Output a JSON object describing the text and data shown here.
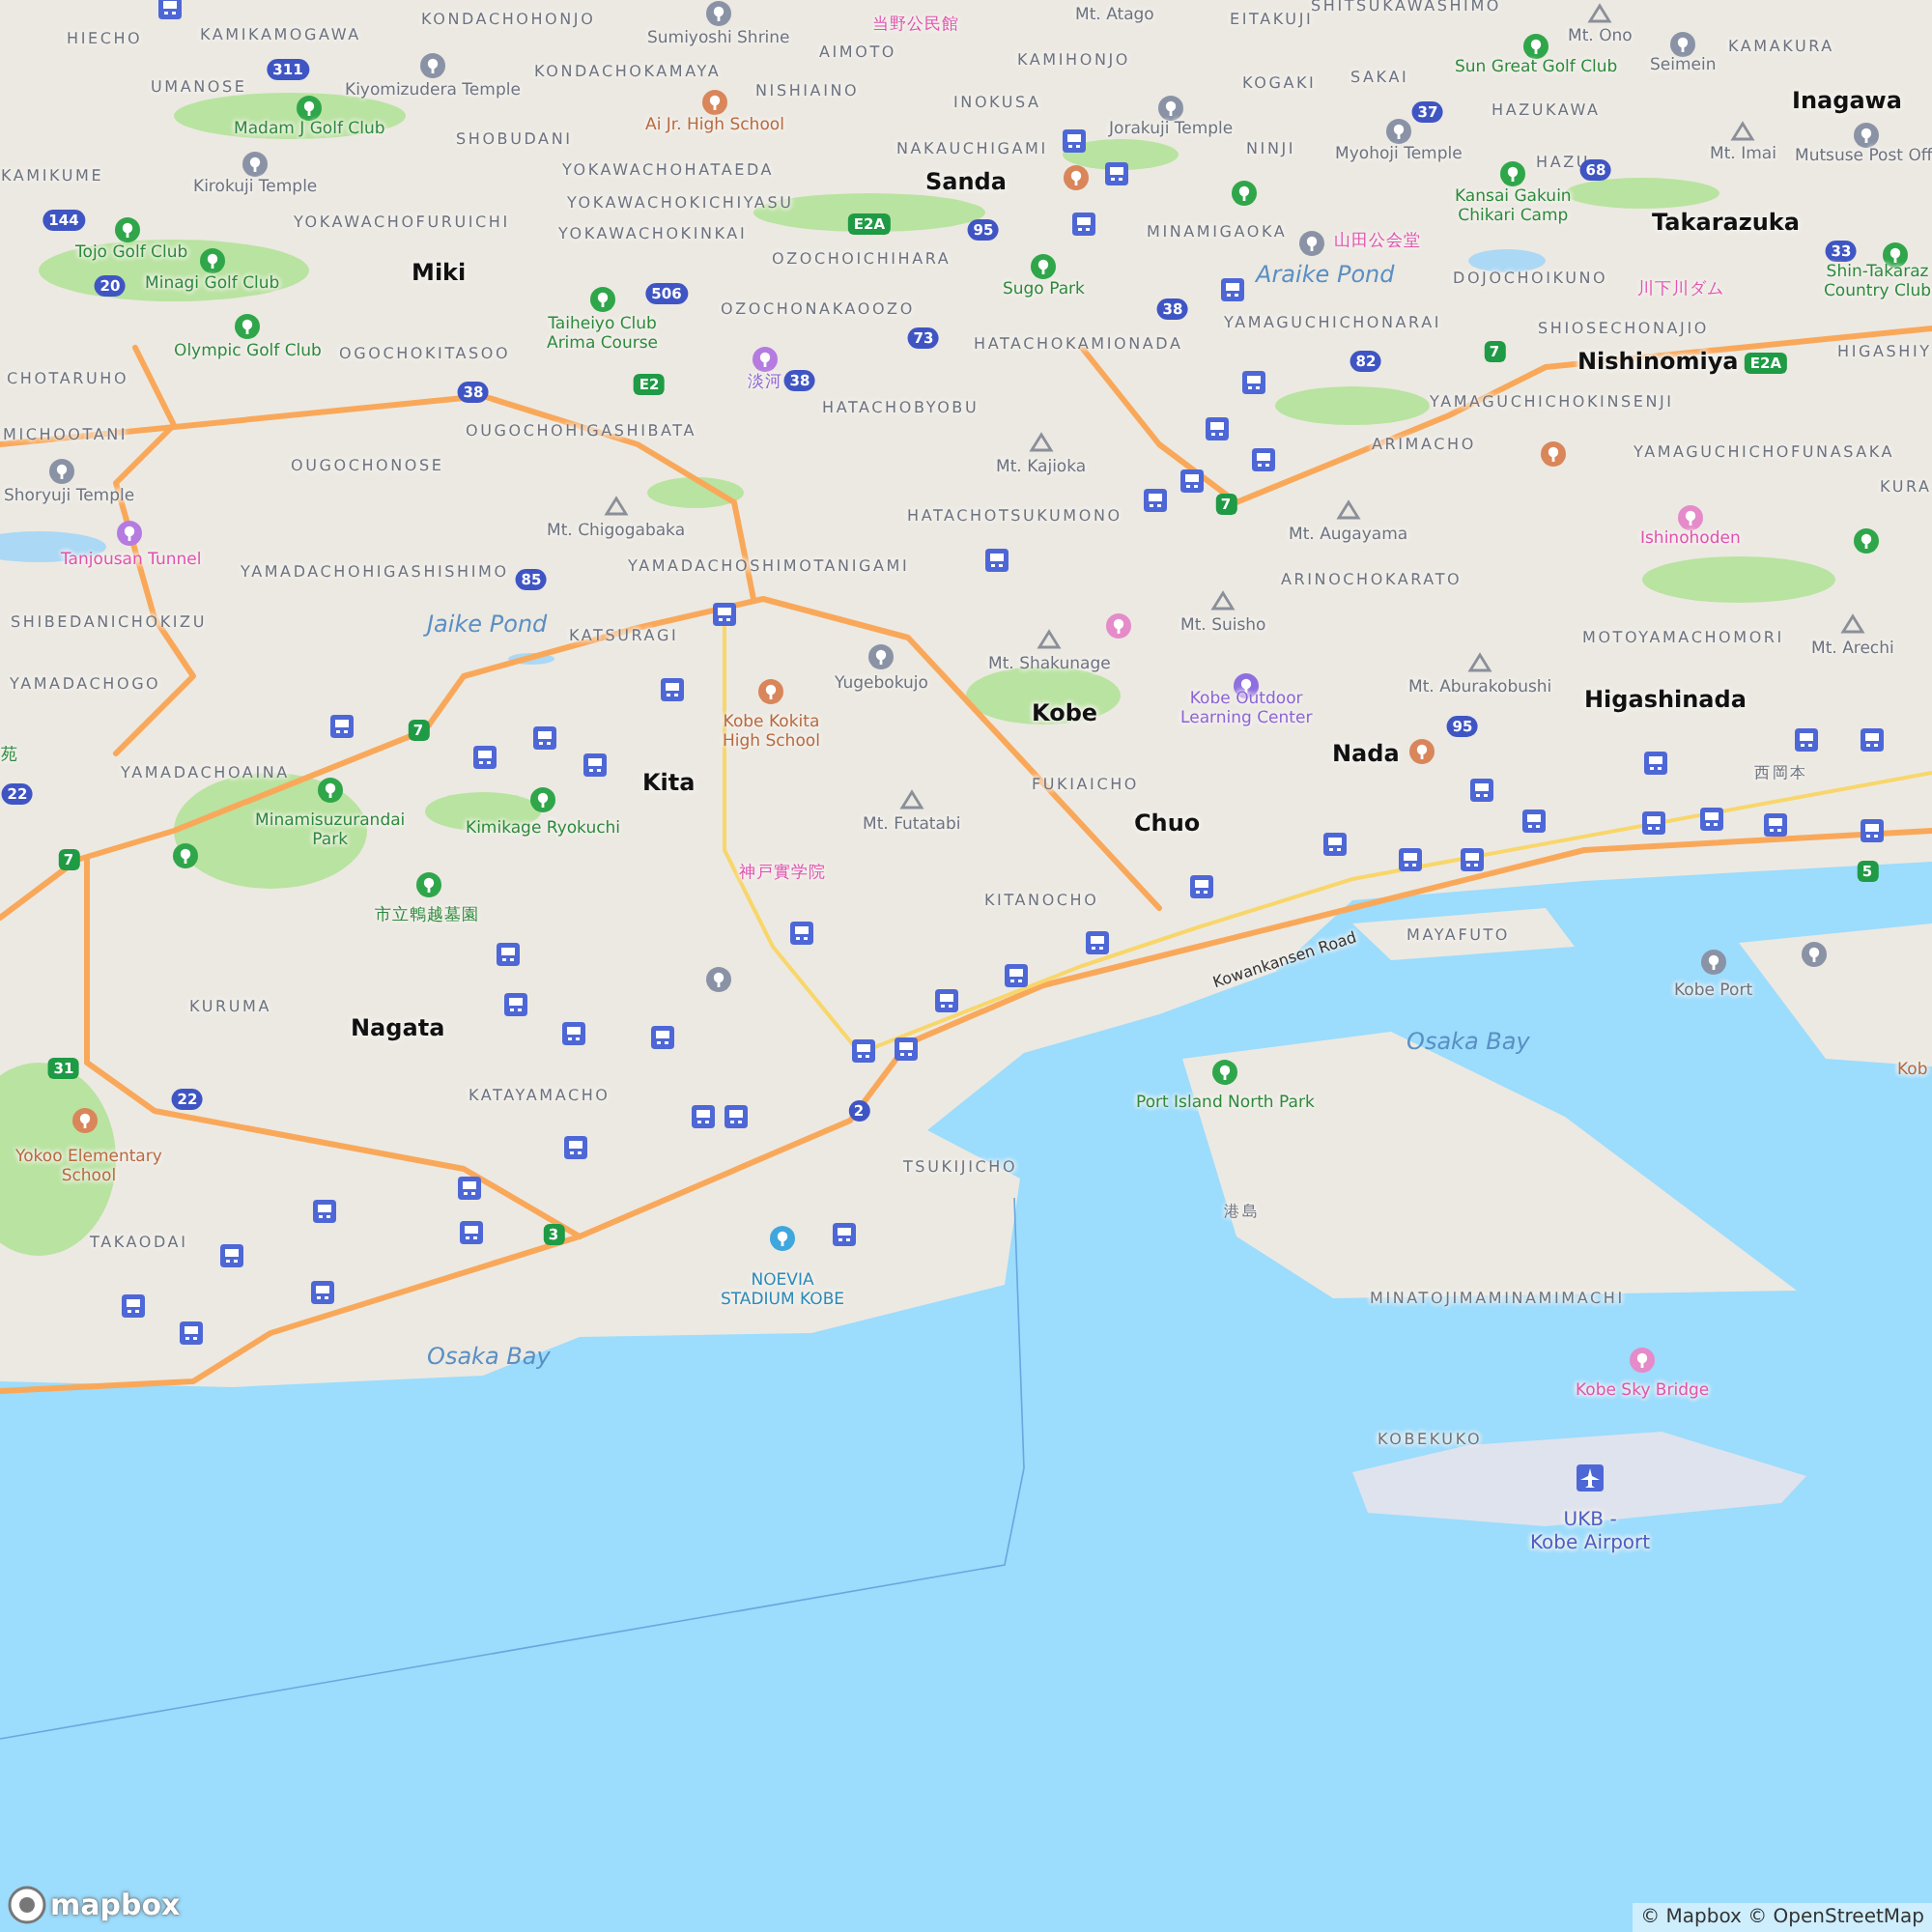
{
  "map": {
    "labels": [
      {
        "kind": "place",
        "text": "KONDACHOHONJO"
      },
      {
        "kind": "poi-pink",
        "text": "当野公民館"
      },
      {
        "kind": "poi-grey",
        "text": "Mt. Atago"
      },
      {
        "kind": "place",
        "text": "EITAKUJI"
      },
      {
        "kind": "place",
        "text": "SHITSUKAWASHIMO"
      },
      {
        "kind": "place",
        "text": "HIECHO"
      },
      {
        "kind": "place",
        "text": "KAMIKAMOGAWA"
      },
      {
        "kind": "poi-grey",
        "text": "Sumiyoshi Shrine"
      },
      {
        "kind": "place",
        "text": "AIMOTO"
      },
      {
        "kind": "poi-grey",
        "text": "Mt. Ono"
      },
      {
        "kind": "place",
        "text": "KAMAKURA"
      },
      {
        "kind": "shield-blue",
        "text": "311"
      },
      {
        "kind": "place",
        "text": "KONDACHOKAMAYA"
      },
      {
        "kind": "place",
        "text": "KAMIHONJO"
      },
      {
        "kind": "place",
        "text": "KOGAKI"
      },
      {
        "kind": "place",
        "text": "SAKAI"
      },
      {
        "kind": "poi-green",
        "text": "Sun Great Golf Club"
      },
      {
        "kind": "poi-grey",
        "text": "Seimein"
      },
      {
        "kind": "place",
        "text": "UMANOSE"
      },
      {
        "kind": "poi-grey",
        "text": "Kiyomizudera Temple"
      },
      {
        "kind": "place",
        "text": "NISHIAINO"
      },
      {
        "kind": "place",
        "text": "INOKUSA"
      },
      {
        "kind": "shield-blue",
        "text": "37"
      },
      {
        "kind": "place",
        "text": "HAZUKAWA"
      },
      {
        "kind": "city",
        "text": "Inagawa"
      },
      {
        "kind": "poi-green",
        "text": "Madam J Golf Club"
      },
      {
        "kind": "place",
        "text": "SHOBUDANI"
      },
      {
        "kind": "poi-brown",
        "text": "Ai Jr. High School"
      },
      {
        "kind": "place",
        "text": "NAKAUCHIGAMI"
      },
      {
        "kind": "poi-grey",
        "text": "Jorakuji Temple"
      },
      {
        "kind": "place",
        "text": "NINJI"
      },
      {
        "kind": "place",
        "text": "KAMIKUME"
      },
      {
        "kind": "place",
        "text": "YOKAWACHOHATAEDA"
      },
      {
        "kind": "poi-grey",
        "text": "Myohoji Temple"
      },
      {
        "kind": "place",
        "text": "HAZU"
      },
      {
        "kind": "shield-blue",
        "text": "68"
      },
      {
        "kind": "poi-grey",
        "text": "Mt. Imai"
      },
      {
        "kind": "poi-grey",
        "text": "Mutsuse Post Off"
      },
      {
        "kind": "poi-grey",
        "text": "Kirokuji Temple"
      },
      {
        "kind": "place",
        "text": "YOKAWACHOKICHIYASU"
      },
      {
        "kind": "city",
        "text": "Sanda"
      },
      {
        "kind": "shield-blue",
        "text": "144"
      },
      {
        "kind": "place",
        "text": "YOKAWACHOFURUICHI"
      },
      {
        "kind": "place",
        "text": "YOKAWACHOKINKAI"
      },
      {
        "kind": "shield-green",
        "text": "E2A"
      },
      {
        "kind": "shield-blue",
        "text": "95"
      },
      {
        "kind": "place",
        "text": "MINAMIGAOKA"
      },
      {
        "kind": "poi-pink",
        "text": "山田公会堂"
      },
      {
        "kind": "poi-green",
        "text": "Kansai Gakuin\nChikari Camp"
      },
      {
        "kind": "city",
        "text": "Takarazuka"
      },
      {
        "kind": "poi-green",
        "text": "Tojo Golf Club"
      },
      {
        "kind": "place",
        "text": "OZOCHOICHIHARA"
      },
      {
        "kind": "shield-blue",
        "text": "33"
      },
      {
        "kind": "shield-blue",
        "text": "20"
      },
      {
        "kind": "poi-green",
        "text": "Minagi Golf Club"
      },
      {
        "kind": "city",
        "text": "Miki"
      },
      {
        "kind": "shield-blue",
        "text": "506"
      },
      {
        "kind": "poi-green",
        "text": "Sugo Park"
      },
      {
        "kind": "water",
        "text": "Araike Pond"
      },
      {
        "kind": "place",
        "text": "DOJOCHOIKUNO"
      },
      {
        "kind": "poi-pink",
        "text": "川下川ダム"
      },
      {
        "kind": "poi-green",
        "text": "Shin-Takaraz\nCountry Club"
      },
      {
        "kind": "place",
        "text": "OZOCHONAKAOOZO"
      },
      {
        "kind": "shield-blue",
        "text": "38"
      },
      {
        "kind": "poi-green",
        "text": "Taiheiyo Club\nArima Course"
      },
      {
        "kind": "shield-blue",
        "text": "73"
      },
      {
        "kind": "place",
        "text": "YAMAGUCHICHONARAI"
      },
      {
        "kind": "place",
        "text": "SHIOSECHONAJIO"
      },
      {
        "kind": "poi-green",
        "text": "Olympic Golf Club"
      },
      {
        "kind": "place",
        "text": "OGOCHOKITASOO"
      },
      {
        "kind": "place",
        "text": "HATACHOKAMIONADA"
      },
      {
        "kind": "shield-blue",
        "text": "82"
      },
      {
        "kind": "shield-green",
        "text": "7"
      },
      {
        "kind": "city",
        "text": "Nishinomiya"
      },
      {
        "kind": "shield-green",
        "text": "E2A"
      },
      {
        "kind": "place",
        "text": "HIGASHIY"
      },
      {
        "kind": "place",
        "text": "CHOTARUHO"
      },
      {
        "kind": "shield-blue",
        "text": "38"
      },
      {
        "kind": "shield-green",
        "text": "E2"
      },
      {
        "kind": "poi-purple",
        "text": "淡河"
      },
      {
        "kind": "shield-blue",
        "text": "38"
      },
      {
        "kind": "place",
        "text": "HATACHOBYOBU"
      },
      {
        "kind": "place",
        "text": "YAMAGUCHICHOKINSENJI"
      },
      {
        "kind": "place",
        "text": "MICHOOTANI"
      },
      {
        "kind": "place",
        "text": "OUGOCHONOSE"
      },
      {
        "kind": "place",
        "text": "OUGOCHOHIGASHIBATA"
      },
      {
        "kind": "poi-grey",
        "text": "Mt. Kajioka"
      },
      {
        "kind": "place",
        "text": "ARIMACHO"
      },
      {
        "kind": "place",
        "text": "YAMAGUCHICHOFUNASAKA"
      },
      {
        "kind": "poi-grey",
        "text": "Shoryuji Temple"
      },
      {
        "kind": "shield-green",
        "text": "7"
      },
      {
        "kind": "place",
        "text": "KURA"
      },
      {
        "kind": "poi-grey",
        "text": "Mt. Chigogabaka"
      },
      {
        "kind": "place",
        "text": "HATACHOTSUKUMONO"
      },
      {
        "kind": "poi-grey",
        "text": "Mt. Augayama"
      },
      {
        "kind": "poi-pink",
        "text": "Ishinohoden"
      },
      {
        "kind": "poi-pink",
        "text": "Tanjousan Tunnel"
      },
      {
        "kind": "place",
        "text": "YAMADACHOHIGASHISHIMO"
      },
      {
        "kind": "shield-blue",
        "text": "85"
      },
      {
        "kind": "place",
        "text": "YAMADACHOSHIMOTANIGAMI"
      },
      {
        "kind": "place",
        "text": "ARINOCHOKARATO"
      },
      {
        "kind": "place",
        "text": "SHIBEDANICHOKIZU"
      },
      {
        "kind": "water",
        "text": "Jaike Pond"
      },
      {
        "kind": "place",
        "text": "KATSURAGI"
      },
      {
        "kind": "poi-grey",
        "text": "Mt. Suisho"
      },
      {
        "kind": "place",
        "text": "MOTOYAMACHOMORI"
      },
      {
        "kind": "poi-grey",
        "text": "Mt. Arechi"
      },
      {
        "kind": "place",
        "text": "YAMADACHOGO"
      },
      {
        "kind": "poi-grey",
        "text": "Yugebokujo"
      },
      {
        "kind": "poi-grey",
        "text": "Mt. Shakunage"
      },
      {
        "kind": "poi-grey",
        "text": "Mt. Aburakobushi"
      },
      {
        "kind": "shield-green",
        "text": "7"
      },
      {
        "kind": "poi-brown",
        "text": "Kobe Kokita\nHigh School"
      },
      {
        "kind": "city",
        "text": "Kobe"
      },
      {
        "kind": "poi-purple",
        "text": "Kobe Outdoor\nLearning Center"
      },
      {
        "kind": "shield-blue",
        "text": "95"
      },
      {
        "kind": "city",
        "text": "Higashinada"
      },
      {
        "kind": "poi-green",
        "text": "苑"
      },
      {
        "kind": "shield-blue",
        "text": "22"
      },
      {
        "kind": "place",
        "text": "YAMADACHOAINA"
      },
      {
        "kind": "city",
        "text": "Kita"
      },
      {
        "kind": "place",
        "text": "FUKIAICHO"
      },
      {
        "kind": "city",
        "text": "Nada"
      },
      {
        "kind": "place",
        "text": "西岡本"
      },
      {
        "kind": "poi-green",
        "text": "Minamisuzurandai\nPark"
      },
      {
        "kind": "poi-green",
        "text": "Kimikage Ryokuchi"
      },
      {
        "kind": "poi-grey",
        "text": "Mt. Futatabi"
      },
      {
        "kind": "city",
        "text": "Chuo"
      },
      {
        "kind": "shield-green",
        "text": "7"
      },
      {
        "kind": "poi-pink",
        "text": "神戸實学院"
      },
      {
        "kind": "shield-green",
        "text": "5"
      },
      {
        "kind": "poi-green",
        "text": "市立鵯越墓園"
      },
      {
        "kind": "place",
        "text": "KITANOCHO"
      },
      {
        "kind": "road",
        "text": "Kowankansen Road"
      },
      {
        "kind": "place",
        "text": "MAYAFUTO"
      },
      {
        "kind": "place",
        "text": "KURUMA"
      },
      {
        "kind": "city",
        "text": "Nagata"
      },
      {
        "kind": "water",
        "text": "Osaka Bay"
      },
      {
        "kind": "poi-grey",
        "text": "Kobe Port"
      },
      {
        "kind": "shield-green",
        "text": "31"
      },
      {
        "kind": "poi-brown",
        "text": "Kob"
      },
      {
        "kind": "shield-blue",
        "text": "22"
      },
      {
        "kind": "place",
        "text": "KATAYAMACHO"
      },
      {
        "kind": "shield-blue",
        "text": "2"
      },
      {
        "kind": "poi-green",
        "text": "Port Island North Park"
      },
      {
        "kind": "poi-brown",
        "text": "Yokoo Elementary\nSchool"
      },
      {
        "kind": "place",
        "text": "TSUKIJICHO"
      },
      {
        "kind": "place",
        "text": "TAKAODAI"
      },
      {
        "kind": "shield-green",
        "text": "3"
      },
      {
        "kind": "place",
        "text": "港島"
      },
      {
        "kind": "poi-teal",
        "text": "NOEVIA\nSTADIUM KOBE"
      },
      {
        "kind": "place",
        "text": "MINATOJIMAMINAMIMACHI"
      },
      {
        "kind": "water",
        "text": "Osaka Bay"
      },
      {
        "kind": "poi-pink",
        "text": "Kobe Sky Bridge"
      },
      {
        "kind": "place",
        "text": "KOBEKUKO"
      },
      {
        "kind": "poi-blue",
        "text": "UKB -\nKobe Airport"
      }
    ],
    "logo": "mapbox",
    "attribution": "© Mapbox © OpenStreetMap"
  }
}
